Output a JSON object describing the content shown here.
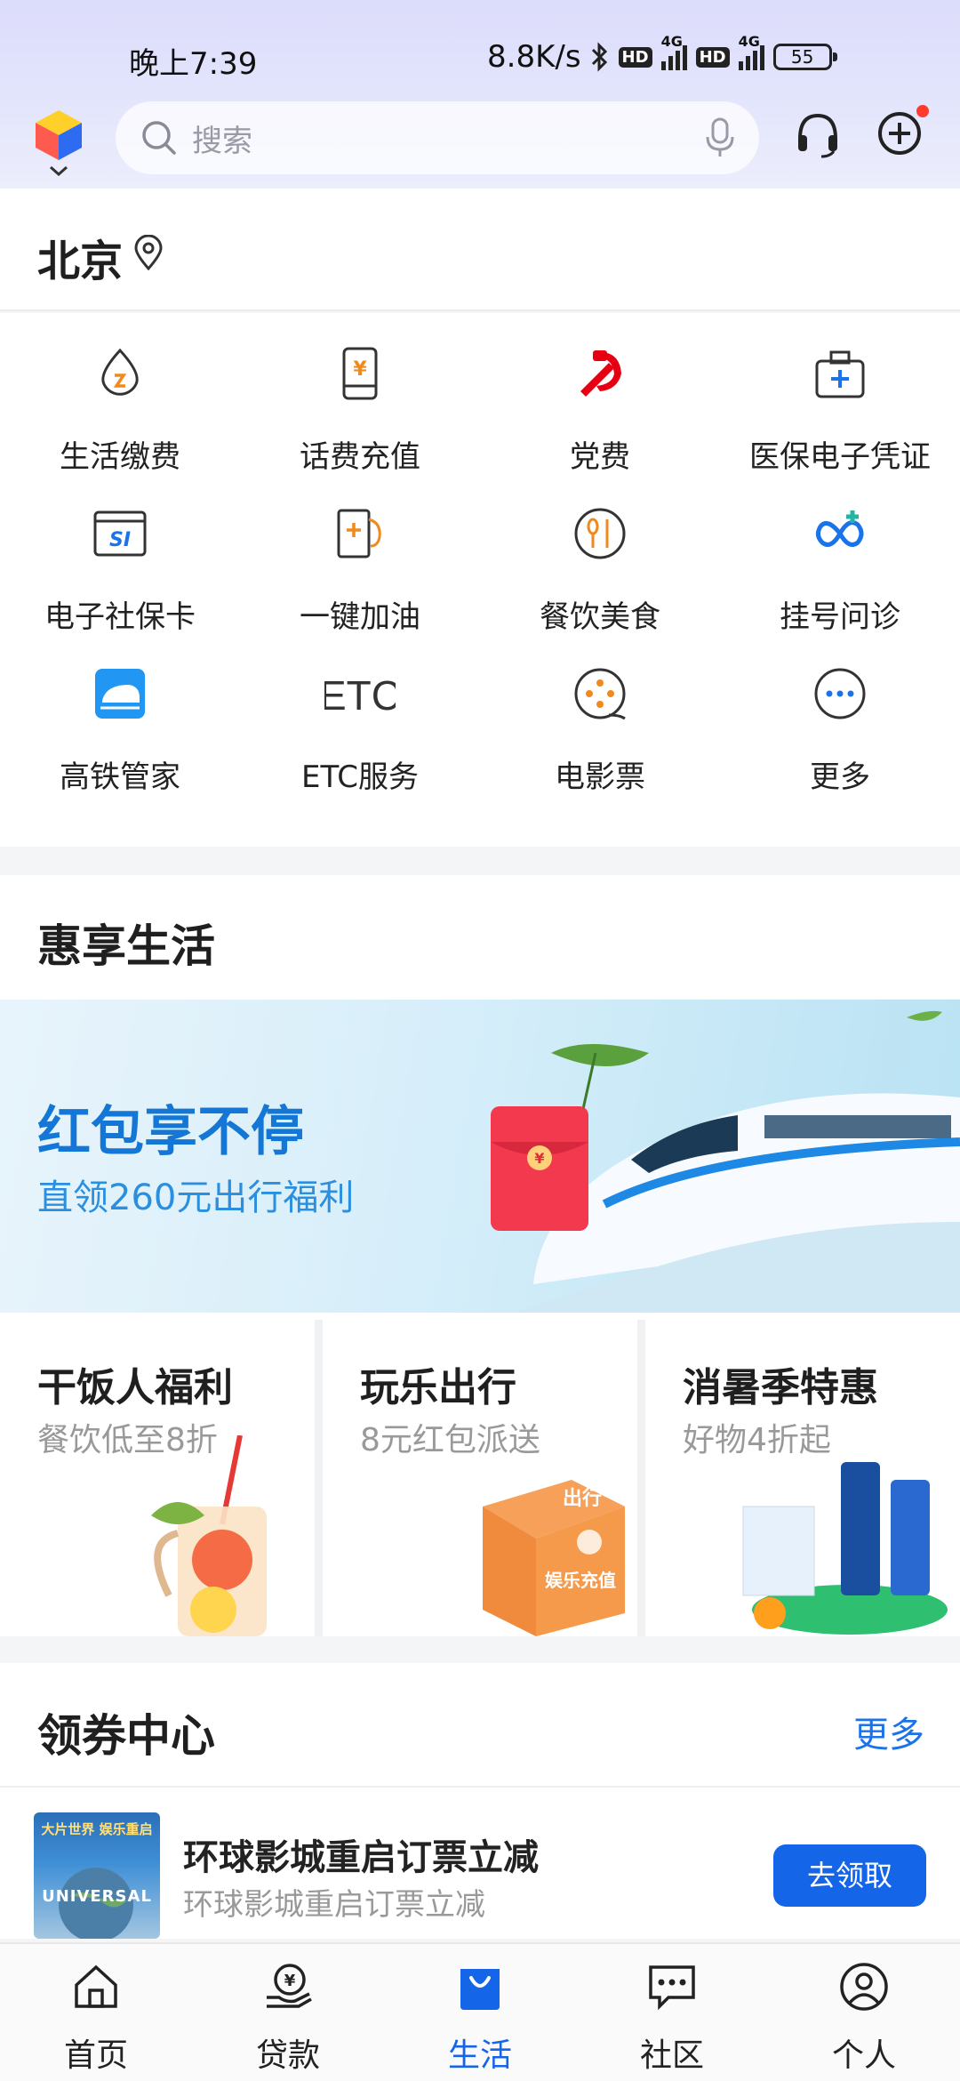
{
  "status_bar": {
    "time": "晚上7:39",
    "speed": "8.8K/s",
    "hd1": "HD",
    "net1": "4G",
    "hd2": "HD",
    "net2": "4G",
    "battery": "55"
  },
  "header": {
    "search_placeholder": "搜索",
    "icons": [
      "app-logo-icon",
      "microphone-icon",
      "headset-icon",
      "add-icon"
    ]
  },
  "city": {
    "name": "北京"
  },
  "services": [
    {
      "label": "生活缴费",
      "icon": "utility-drop-icon"
    },
    {
      "label": "话费充值",
      "icon": "phone-topup-icon"
    },
    {
      "label": "党费",
      "icon": "party-emblem-icon"
    },
    {
      "label": "医保电子凭证",
      "icon": "medical-kit-icon"
    },
    {
      "label": "电子社保卡",
      "icon": "social-security-card-icon"
    },
    {
      "label": "一键加油",
      "icon": "fuel-pump-icon"
    },
    {
      "label": "餐饮美食",
      "icon": "dining-icon"
    },
    {
      "label": "挂号问诊",
      "icon": "registration-icon"
    },
    {
      "label": "高铁管家",
      "icon": "high-speed-rail-icon"
    },
    {
      "label": "ETC服务",
      "icon": "etc-icon"
    },
    {
      "label": "电影票",
      "icon": "movie-ticket-icon"
    },
    {
      "label": "更多",
      "icon": "more-icon"
    }
  ],
  "promo": {
    "title": "惠享生活",
    "banner": {
      "headline": "红包享不停",
      "sub": "直领260元出行福利",
      "envelope_mark": "¥"
    },
    "cards": [
      {
        "title": "干饭人福利",
        "sub": "餐饮低至8折"
      },
      {
        "title": "玩乐出行",
        "sub": "8元红包派送",
        "box_text_1": "出行",
        "box_text_2": "娱乐充值"
      },
      {
        "title": "消暑季特惠",
        "sub": "好物4折起"
      }
    ]
  },
  "coupon_center": {
    "title": "领券中心",
    "more": "更多",
    "item": {
      "thumb_text": "大片世界 娱乐重启",
      "thumb_logo": "UNIVERSAL",
      "title": "环球影城重启订票立减",
      "sub": "环球影城重启订票立减",
      "button": "去领取"
    }
  },
  "bottom_nav": [
    {
      "label": "首页",
      "icon": "home-icon",
      "active": false
    },
    {
      "label": "贷款",
      "icon": "loan-icon",
      "active": false
    },
    {
      "label": "生活",
      "icon": "life-bag-icon",
      "active": true
    },
    {
      "label": "社区",
      "icon": "community-chat-icon",
      "active": false
    },
    {
      "label": "个人",
      "icon": "profile-icon",
      "active": false
    }
  ],
  "colors": {
    "accent": "#1565e8",
    "party_red": "#e60012",
    "orange": "#f08a1c",
    "teal": "#21b5a6"
  }
}
